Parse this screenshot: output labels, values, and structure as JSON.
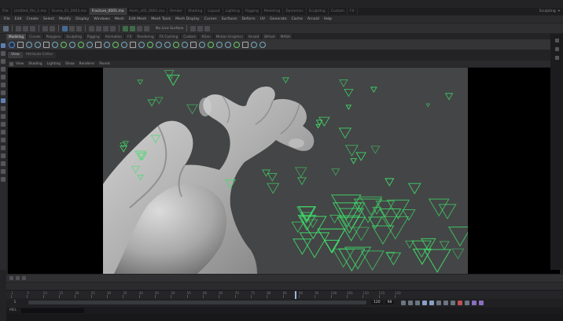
{
  "tabs": [
    {
      "label": "File"
    },
    {
      "label": "Untitled_File_1.ma"
    },
    {
      "label": "Scene_01_0003.ma"
    },
    {
      "label": "Fracture_0001.ma",
      "active": true
    },
    {
      "label": "Anim_v02_0001.ma"
    },
    {
      "label": "Render"
    },
    {
      "label": "Shading"
    },
    {
      "label": "Layout"
    },
    {
      "label": "Lighting"
    },
    {
      "label": "Rigging"
    },
    {
      "label": "Modeling"
    },
    {
      "label": "Dynamics"
    },
    {
      "label": "Sculpting"
    },
    {
      "label": "Custom"
    },
    {
      "label": "FX"
    }
  ],
  "workspace": "Sculpting",
  "menus": [
    "File",
    "Edit",
    "Create",
    "Select",
    "Modify",
    "Display",
    "Windows",
    "Mesh",
    "Edit Mesh",
    "Mesh Tools",
    "Mesh Display",
    "Curves",
    "Surfaces",
    "Deform",
    "UV",
    "Generate",
    "Cache",
    "Arnold",
    "Help"
  ],
  "status_text": "No Live Surface",
  "shelf_tabs": [
    {
      "label": "Modeling",
      "active": true
    },
    {
      "label": "Curves"
    },
    {
      "label": "Polygons"
    },
    {
      "label": "Sculpting"
    },
    {
      "label": "Rigging"
    },
    {
      "label": "Animation"
    },
    {
      "label": "FX"
    },
    {
      "label": "Rendering"
    },
    {
      "label": "FX Caching"
    },
    {
      "label": "Custom"
    },
    {
      "label": "XGen"
    },
    {
      "label": "Motion Graphics"
    },
    {
      "label": "Arnold"
    },
    {
      "label": "Bifrost"
    },
    {
      "label": "MASH"
    }
  ],
  "panel_tabs": [
    "View",
    "Attribute Editor"
  ],
  "panel_menu": [
    "View",
    "Shading",
    "Lighting",
    "Show",
    "Renderer",
    "Panels"
  ],
  "viewport": {
    "background": "#444546",
    "marker_color": "#3fdc6a",
    "object_color": "#b8b8b8"
  },
  "timeline": {
    "ticks": [
      "1",
      "5",
      "10",
      "15",
      "20",
      "25",
      "30",
      "35",
      "40",
      "45",
      "50",
      "55",
      "60",
      "65",
      "70",
      "75",
      "80",
      "85",
      "90",
      "95",
      "100",
      "105",
      "110",
      "115",
      "120"
    ],
    "current_frame_fraction": 0.74
  },
  "range": {
    "start": "1",
    "end": "120",
    "current": "98"
  },
  "command_label": "MEL"
}
